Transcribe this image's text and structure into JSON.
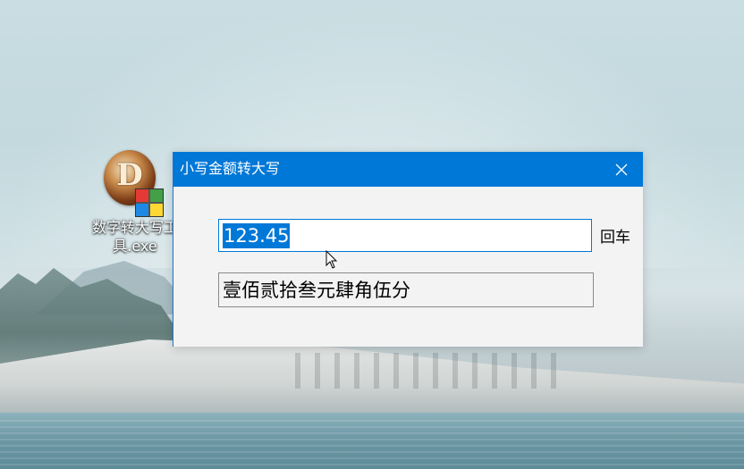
{
  "desktop": {
    "icon": {
      "letter": "D",
      "label": "数字转大写工具.exe",
      "icon_name": "app-icon-d",
      "grid_colors": [
        "#e53935",
        "#43a047",
        "#1e88e5",
        "#fdd835"
      ]
    }
  },
  "window": {
    "title": "小写金额转大写",
    "close_icon": "close-icon",
    "title_bar_color": "#0078d7",
    "input": {
      "value": "123.45"
    },
    "enter_label": "回车",
    "result": {
      "value": "壹佰贰拾叁元肆角伍分"
    }
  },
  "cursor": {
    "icon_name": "arrow-cursor-icon"
  }
}
